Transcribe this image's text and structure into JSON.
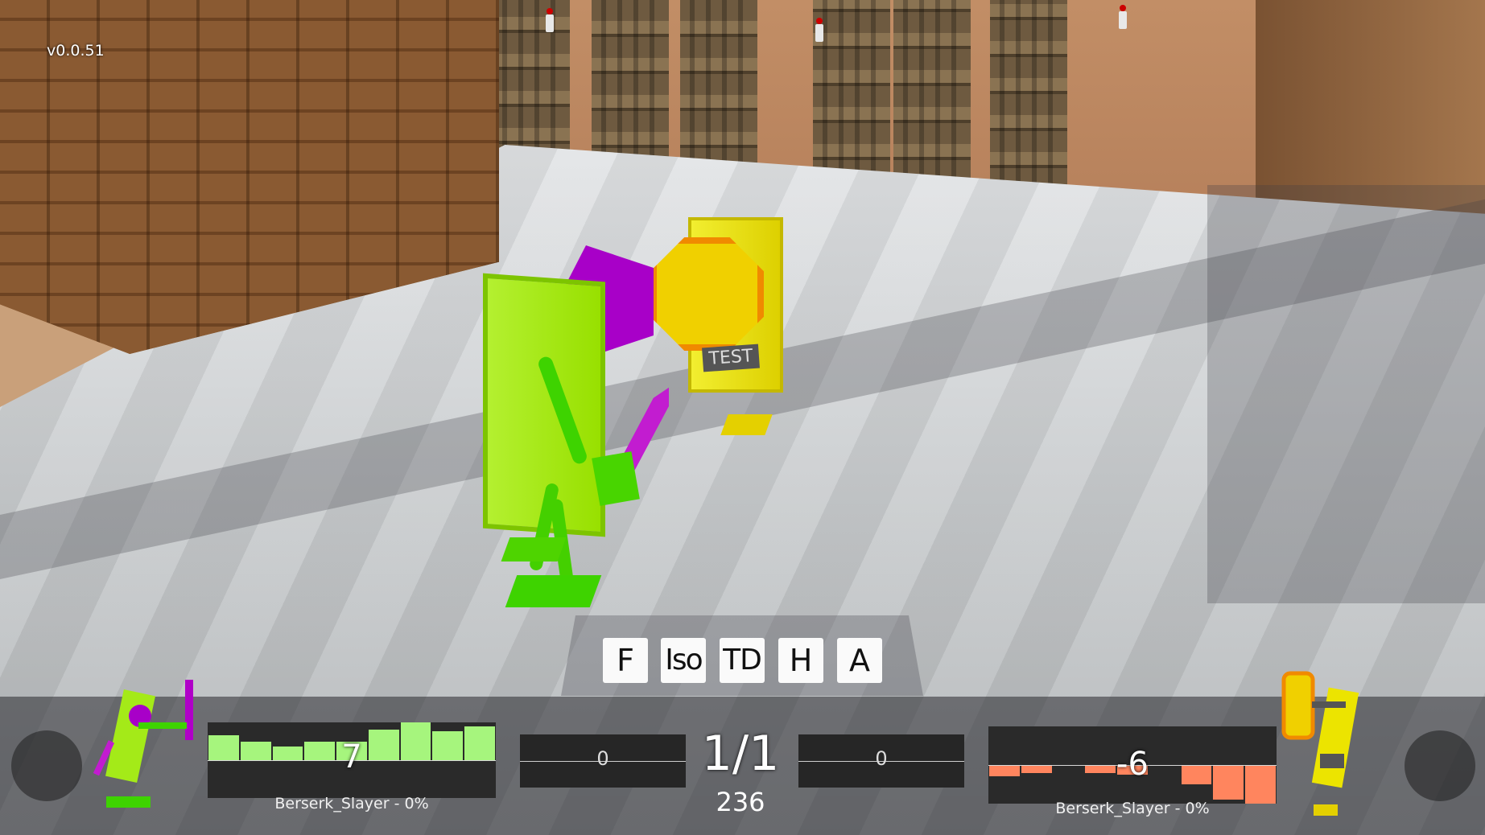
{
  "version": "v0.0.51",
  "camera_buttons": [
    "F",
    "Iso",
    "TD",
    "H",
    "A"
  ],
  "round": "1/1",
  "timer": "236",
  "left_score": "0",
  "right_score": "0",
  "test_label": "TEST",
  "player_left": {
    "name_caption": "Berserk_Slayer - 0%",
    "graph_value": "7",
    "bar_color": "#a6f57d",
    "bars": [
      0.33,
      0.25,
      0.18,
      0.25,
      0.25,
      0.4,
      0.5,
      0.38,
      0.45
    ]
  },
  "player_right": {
    "name_caption": "Berserk_Slayer - 0%",
    "graph_value": "-6",
    "bar_color": "#ff855e",
    "bars": [
      0.15,
      0.1,
      0.0,
      0.1,
      0.12,
      0.0,
      0.25,
      0.45,
      0.55
    ]
  }
}
